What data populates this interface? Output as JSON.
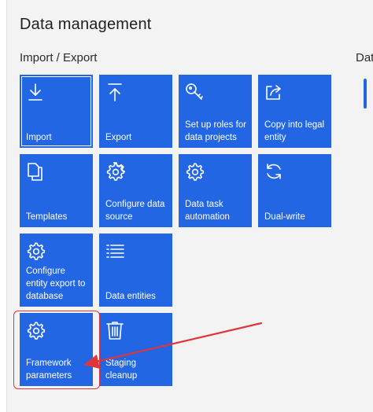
{
  "page": {
    "title": "Data management"
  },
  "sections": {
    "import_export": "Import / Export",
    "second_cut": "Dat"
  },
  "tiles": [
    {
      "label": "Import",
      "icon": "download-icon"
    },
    {
      "label": "Export",
      "icon": "upload-icon"
    },
    {
      "label": "Set up roles for data projects",
      "icon": "key-icon"
    },
    {
      "label": "Copy into legal entity",
      "icon": "share-icon"
    },
    {
      "label": "Templates",
      "icon": "copy-icon"
    },
    {
      "label": "Configure data source",
      "icon": "gear-icon"
    },
    {
      "label": "Data task automation",
      "icon": "gear-icon"
    },
    {
      "label": "Dual-write",
      "icon": "refresh-icon"
    },
    {
      "label": "Configure entity export to database",
      "icon": "gear-icon"
    },
    {
      "label": "Data entities",
      "icon": "list-icon"
    },
    {
      "label": "Framework parameters",
      "icon": "gear-icon"
    },
    {
      "label": "Staging cleanup",
      "icon": "trash-icon"
    }
  ],
  "colors": {
    "tile": "#2266e3",
    "annotation": "#e0353b"
  }
}
